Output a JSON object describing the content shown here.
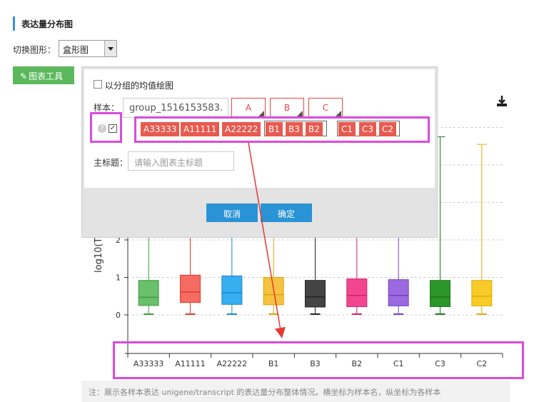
{
  "header": {
    "title": "表达量分布图"
  },
  "switch": {
    "label": "切换图形：",
    "value": "盒形图"
  },
  "toolbar": {
    "tool_label": "图表工具"
  },
  "popup": {
    "avg_label": "以分组的均值绘图",
    "sample_label": "样本：",
    "group_value": "group_1516153583.",
    "groups": [
      "A",
      "B",
      "C"
    ],
    "tag_groups": [
      [
        "A33333",
        "A11111",
        "A22222"
      ],
      [
        "B1",
        "B3",
        "B2"
      ],
      [
        "C1",
        "C3",
        "C2"
      ]
    ],
    "main_title_label": "主标题：",
    "main_title_placeholder": "请输入图表主标题",
    "cancel_label": "取消",
    "ok_label": "确定",
    "accent_color": "#e85a4f"
  },
  "chart_data": {
    "type": "box",
    "ylabel": "log10(T",
    "yticks": [
      "0",
      "1",
      "2"
    ],
    "categories": [
      "A33333",
      "A11111",
      "A22222",
      "B1",
      "B3",
      "B2",
      "C1",
      "C3",
      "C2"
    ],
    "boxes": [
      {
        "name": "A33333",
        "min": 0.02,
        "q1": 0.25,
        "median": 0.47,
        "q3": 0.92,
        "max": 2.4,
        "color": "#6abf6a",
        "stroke": "#3e9a3e"
      },
      {
        "name": "A11111",
        "min": 0.02,
        "q1": 0.33,
        "median": 0.61,
        "q3": 1.06,
        "max": 2.4,
        "color": "#f46b62",
        "stroke": "#e03a30"
      },
      {
        "name": "A22222",
        "min": 0.02,
        "q1": 0.28,
        "median": 0.59,
        "q3": 1.04,
        "max": 2.4,
        "color": "#36aef0",
        "stroke": "#1a88c8"
      },
      {
        "name": "B1",
        "min": 0.02,
        "q1": 0.27,
        "median": 0.54,
        "q3": 1.0,
        "max": 2.4,
        "color": "#f5c242",
        "stroke": "#e0a400"
      },
      {
        "name": "B3",
        "min": 0.02,
        "q1": 0.21,
        "median": 0.48,
        "q3": 0.92,
        "max": 2.4,
        "color": "#444444",
        "stroke": "#222222"
      },
      {
        "name": "B2",
        "min": 0.02,
        "q1": 0.22,
        "median": 0.52,
        "q3": 0.96,
        "max": 2.4,
        "color": "#f2468f",
        "stroke": "#d21e6e"
      },
      {
        "name": "C1",
        "min": 0.02,
        "q1": 0.24,
        "median": 0.52,
        "q3": 0.94,
        "max": 2.4,
        "color": "#9b6ae0",
        "stroke": "#7440c0"
      },
      {
        "name": "C3",
        "min": 0.02,
        "q1": 0.22,
        "median": 0.48,
        "q3": 0.92,
        "max": 4.75,
        "color": "#2b962b",
        "stroke": "#1b781b"
      },
      {
        "name": "C2",
        "min": 0.02,
        "q1": 0.24,
        "median": 0.5,
        "q3": 0.92,
        "max": 4.55,
        "color": "#f7cc2a",
        "stroke": "#e0aa00"
      }
    ]
  },
  "note": {
    "text": "注：展示各样本表达 unigene/transcript 的表达量分布整体情况。横坐标为样本名，纵坐标为各样本"
  },
  "highlight_color": "#d94bdd"
}
